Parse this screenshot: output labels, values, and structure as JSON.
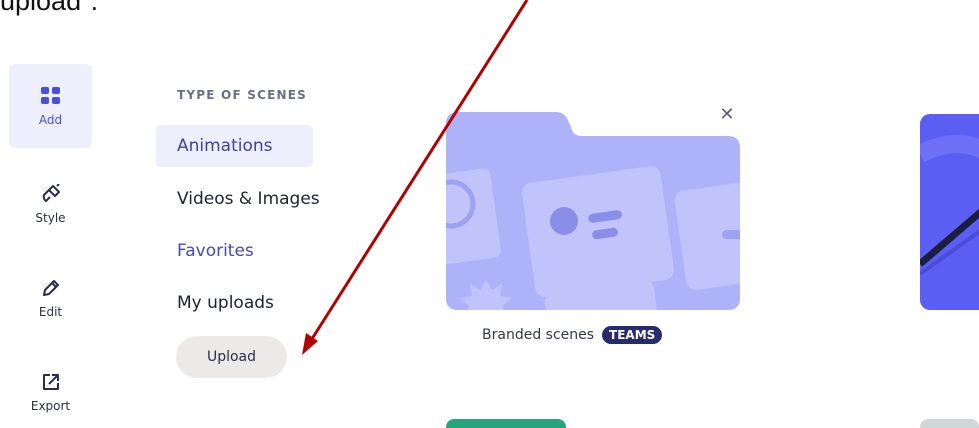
{
  "caption": {
    "text": "upload\"."
  },
  "rail": {
    "items": [
      {
        "label": "Add",
        "icon": "grid-icon",
        "active": true
      },
      {
        "label": "Style",
        "icon": "paint-icon",
        "active": false
      },
      {
        "label": "Edit",
        "icon": "pencil-icon",
        "active": false
      },
      {
        "label": "Export",
        "icon": "export-icon",
        "active": false
      }
    ]
  },
  "scenes": {
    "section_title": "TYPE OF SCENES",
    "items": [
      {
        "label": "Animations",
        "active": true
      },
      {
        "label": "Videos & Images",
        "active": false
      },
      {
        "label": "Favorites",
        "active": false
      },
      {
        "label": "My uploads",
        "active": false
      }
    ],
    "upload_label": "Upload"
  },
  "cards": {
    "branded": {
      "caption": "Branded scenes",
      "badge": "TEAMS"
    }
  },
  "colors": {
    "accent": "#4b4fd8",
    "active_bg": "#eeeffc",
    "badge_bg": "#262a6e",
    "card_purple": "#aeb2f8",
    "arrow": "#b00000"
  }
}
